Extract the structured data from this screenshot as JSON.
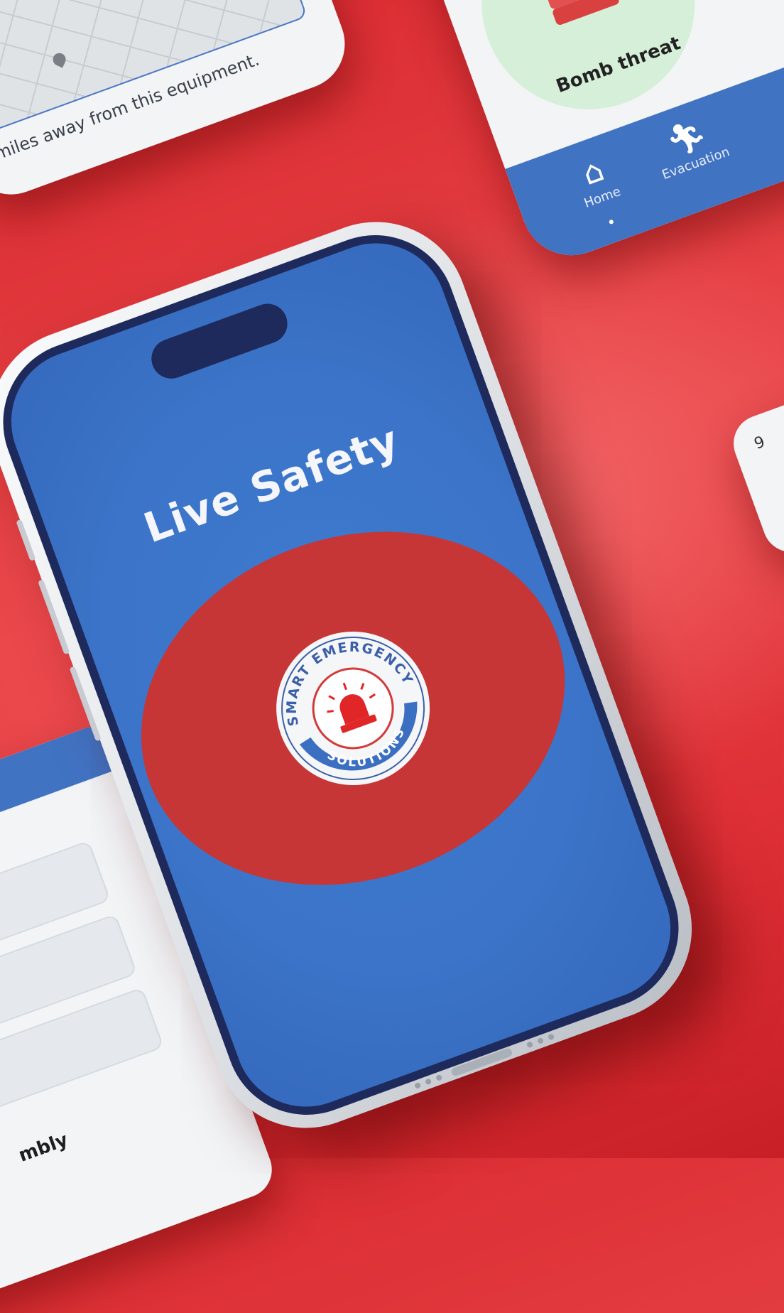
{
  "map_card": {
    "caption": "miles away from this equipment.",
    "open_map_icon": "open-in-new-icon"
  },
  "bomb_card": {
    "label": "Bomb threat",
    "nav": [
      {
        "label": "Home",
        "icon": "home-icon"
      },
      {
        "label": "Evacuation",
        "icon": "running-person-icon"
      }
    ]
  },
  "right_card": {
    "fragment": "9"
  },
  "form_card": {
    "assembly_label": "mbly"
  },
  "phone": {
    "title": "Live Safety",
    "logo": {
      "top_text": "SMART EMERGENCY",
      "bottom_text": "SOLUTIONS",
      "icon": "siren-icon"
    }
  },
  "colors": {
    "primary_blue": "#3b74c8",
    "alarm_red": "#c63637",
    "background_red": "#e03a3e",
    "navy": "#1f2a5c"
  }
}
